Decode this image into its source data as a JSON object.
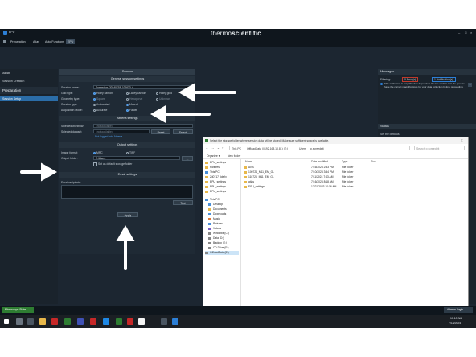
{
  "app": {
    "window_title": "EPU",
    "brand_thin": "thermo",
    "brand_bold": "scientific"
  },
  "menu": [
    "Preparation",
    "Atlas",
    "Auto Functions",
    "EPU"
  ],
  "sidebar": {
    "start": "Start",
    "session_creation": "Session Creation",
    "preparation": "Preparation",
    "session_setup": "Session Setup"
  },
  "session": {
    "panel_title": "Session",
    "general_title": "General session settings",
    "session_name_label": "Session name:",
    "session_name_value": "Supervisor_20240718_101633_6",
    "grid_type_label": "Grid type:",
    "grid_options": [
      "Holey carbon",
      "Lacey carbon",
      "Holey gold"
    ],
    "geometry_label": "Geometry type:",
    "geometry_options": [
      "Square",
      "Hexagonal",
      "Unknown"
    ],
    "session_type_label": "Session type:",
    "session_type_options": [
      "Automated",
      "Manual"
    ],
    "acq_mode_label": "Acquisition Mode:",
    "acq_mode_options": [
      "Accurate",
      "Faster"
    ],
    "athena_title": "Athena settings",
    "workflow_label": "Selected workflow:",
    "workflow_value": "<not available>",
    "dataset_label": "Selected dataset:",
    "dataset_value": "<not available>",
    "reset_btn": "Reset",
    "select_btn": "Select",
    "not_logged": "Not logged into Athena",
    "output_title": "Output settings",
    "image_format_label": "Image format:",
    "image_format_options": [
      "MRC",
      "TIFF"
    ],
    "output_folder_label": "Output folder:",
    "output_folder_value": "E:\\Users",
    "browse_btn": "...",
    "default_storage": "Set as default storage folder",
    "email_title": "Email settings",
    "email_label": "Email recipients:",
    "test_btn": "Test",
    "apply_btn": "Apply"
  },
  "right": {
    "messages_title": "Messages",
    "filtering": "Filtering:",
    "errors": "0 Error(s)",
    "notifications": "1 Notification(s)",
    "message_text": "This calibration is magnification dependent. Please confirm that the presets have the correct magnifications for your data collection before proceeding.",
    "status_title": "Status",
    "set_defocus": "Set the defocus"
  },
  "statusbar": {
    "left": "Microscope State",
    "right": "Athena Login"
  },
  "taskbar": {
    "time": "10:10 AM",
    "date": "7/18/2024"
  },
  "dialog": {
    "title": "Select the storage folder where session data will be stored. Make sure sufficient space is available.",
    "path": [
      "This PC",
      "OffloadData (\\\\192.168.10.81) (Z:)",
      "Users",
      "p.screedeit"
    ],
    "search_placeholder": "Search p.screedeit",
    "organize": "Organize ▾",
    "new_folder": "New folder",
    "columns": [
      "Name",
      "Date modified",
      "Type",
      "Size"
    ],
    "tree": [
      "EPU_settings",
      "Pictures",
      "This PC",
      "240717_Idefix",
      "EPU_settings",
      "EPU_settings",
      "EPU_settings",
      "This PC",
      "Desktop",
      "Documents",
      "Downloads",
      "Music",
      "Pictures",
      "Videos",
      "Windows (C:)",
      "Data (D:)",
      "Backup (E:)",
      "CD Drive (F:)",
      "OffloadData (Z:)"
    ],
    "files": [
      {
        "name": "ANS",
        "date": "7/16/2024 2:53 PM",
        "type": "File folder"
      },
      {
        "name": "100724_M11_EM_GL",
        "date": "7/10/2024 3:44 PM",
        "type": "File folder"
      },
      {
        "name": "110724_M11_EM_GL",
        "date": "7/11/2024 7:43 AM",
        "type": "File folder"
      },
      {
        "name": "atlas",
        "date": "7/16/2024 8:18 AM",
        "type": "File folder"
      },
      {
        "name": "EPU_settings",
        "date": "12/21/2023 10:16 AM",
        "type": "File folder"
      }
    ],
    "folder_label": "Folder:",
    "folder_value": "p.screedeit",
    "select_btn": "Select Folder",
    "cancel_btn": "Cancel"
  }
}
